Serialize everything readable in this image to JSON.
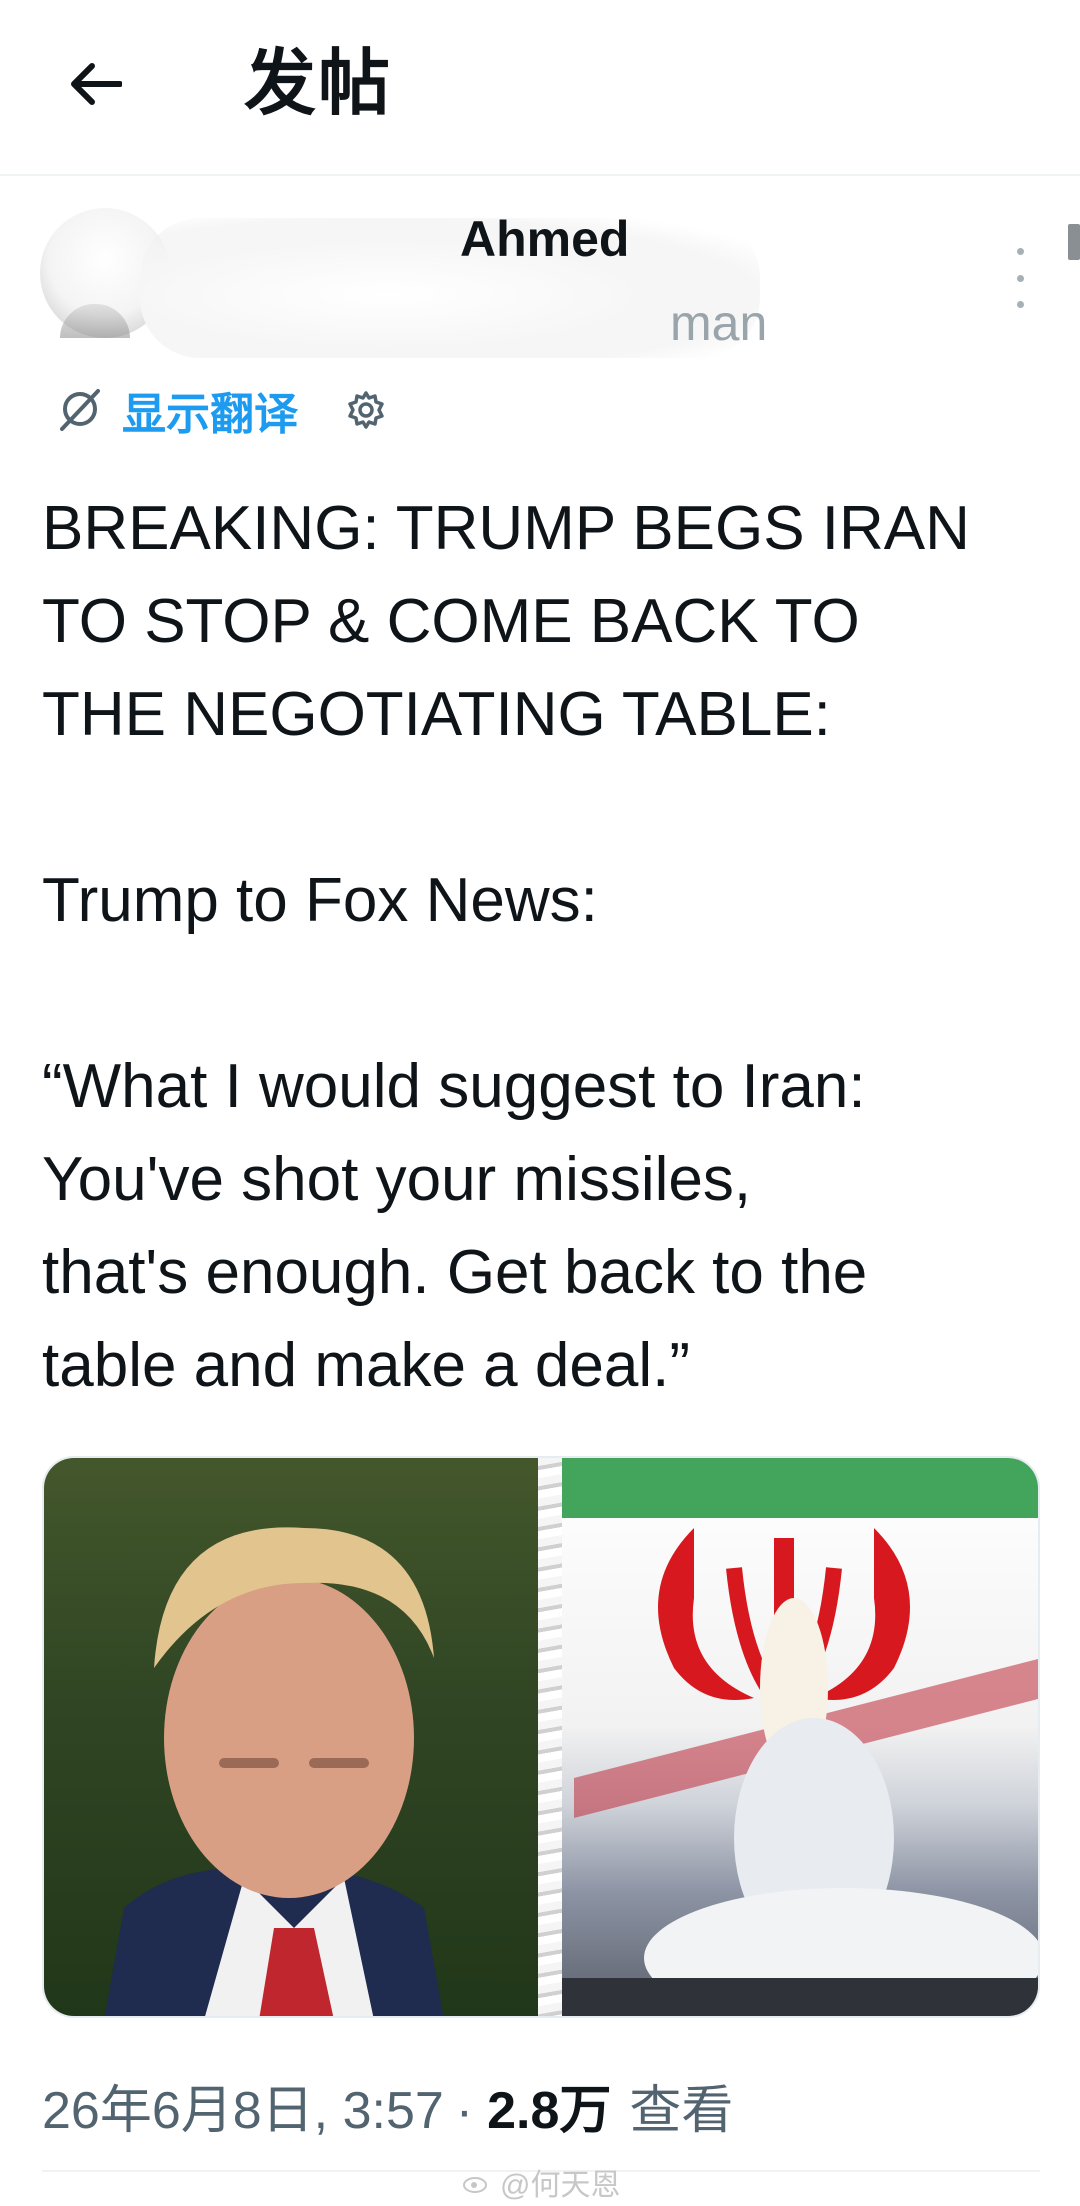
{
  "header": {
    "title": "发帖",
    "back_icon": "arrow-left-icon"
  },
  "author": {
    "display_name_visible": "Ahmed",
    "handle_visible": "man"
  },
  "translate": {
    "label": "显示翻译",
    "settings_icon": "gear-icon"
  },
  "tweet": {
    "text": "BREAKING: TRUMP BEGS IRAN\nTO STOP & COME BACK TO\nTHE NEGOTIATING TABLE:\n\nTrump to Fox News:\n\n“What I would suggest to Iran:\nYou've shot your missiles,\nthat's enough. Get back to the\ntable and make a deal.”"
  },
  "meta": {
    "datetime": "26年6月8日, 3:57",
    "separator": "·",
    "views_count": "2.8万",
    "views_label": "查看"
  },
  "watermark": {
    "text": "@何天恩"
  },
  "colors": {
    "accent": "#1d9bf0",
    "text": "#0f1419",
    "muted": "#536471"
  }
}
